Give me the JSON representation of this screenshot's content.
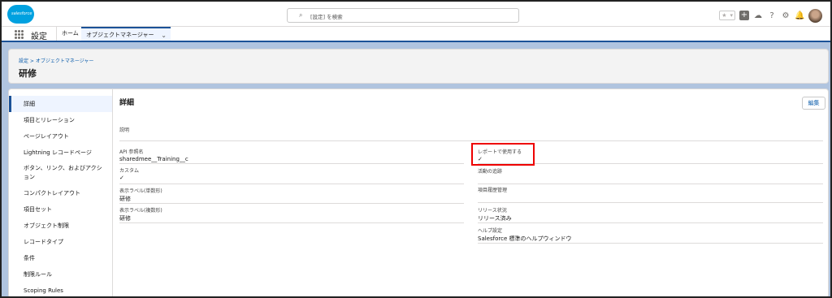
{
  "header": {
    "logo_text": "salesforce",
    "search_placeholder": "[設定] を検索",
    "icons": [
      "star-icon",
      "chevron-down-icon",
      "plus-icon",
      "trailhead-icon",
      "help-icon",
      "gear-icon",
      "bell-icon",
      "avatar"
    ]
  },
  "nav": {
    "app_name": "設定",
    "tabs": [
      {
        "label": "ホーム"
      },
      {
        "label": "オブジェクトマネージャー"
      }
    ]
  },
  "page": {
    "breadcrumb": "設定 > オブジェクトマネージャー",
    "title": "研修"
  },
  "sidebar": {
    "items": [
      {
        "label": "詳細"
      },
      {
        "label": "項目とリレーション"
      },
      {
        "label": "ページレイアウト"
      },
      {
        "label": "Lightning レコードページ"
      },
      {
        "label": "ボタン、リンク、およびアクション"
      },
      {
        "label": "コンパクトレイアウト"
      },
      {
        "label": "項目セット"
      },
      {
        "label": "オブジェクト制限"
      },
      {
        "label": "レコードタイプ"
      },
      {
        "label": "条件"
      },
      {
        "label": "制限ルール"
      },
      {
        "label": "Scoping Rules"
      }
    ]
  },
  "detail": {
    "title": "詳細",
    "edit_label": "編集",
    "description": {
      "label": "説明",
      "value": ""
    },
    "left_fields": [
      {
        "label": "API 参照名",
        "value": "sharedmee__Training__c"
      },
      {
        "label": "カスタム",
        "value": "✓"
      },
      {
        "label": "表示ラベル(単数形)",
        "value": "研修"
      },
      {
        "label": "表示ラベル(複数形)",
        "value": "研修"
      }
    ],
    "right_fields": [
      {
        "label": "レポートで使用する",
        "value": "✓"
      },
      {
        "label": "活動の追跡",
        "value": ""
      },
      {
        "label": "項目履歴管理",
        "value": ""
      },
      {
        "label": "リリース状況",
        "value": "リリース済み"
      },
      {
        "label": "ヘルプ設定",
        "value": "Salesforce 標準のヘルプウィンドウ"
      }
    ]
  },
  "colors": {
    "brand": "#00a1e0",
    "link": "#0b5cab",
    "nav_accent": "#1b5297",
    "highlight": "#ee0000"
  }
}
